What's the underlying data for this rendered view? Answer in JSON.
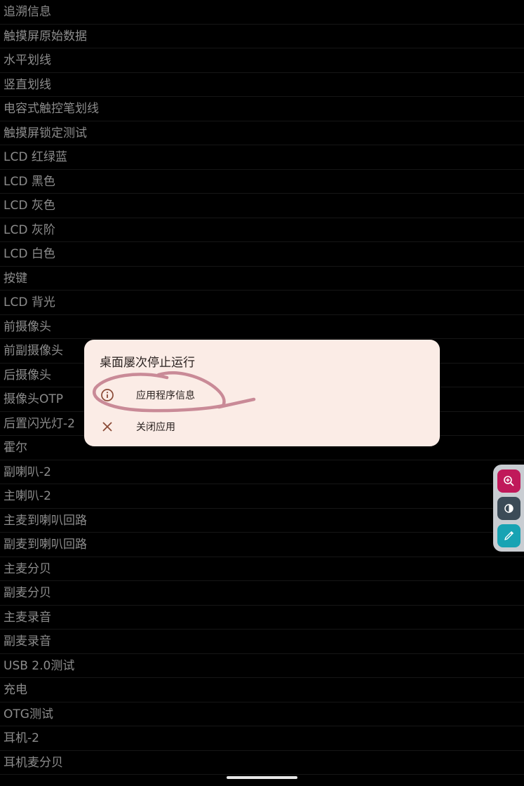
{
  "test_list": [
    "追溯信息",
    "触摸屏原始数据",
    "水平划线",
    "竖直划线",
    "电容式触控笔划线",
    "触摸屏锁定测试",
    "LCD 红绿蓝",
    "LCD 黑色",
    "LCD 灰色",
    "LCD 灰阶",
    "LCD 白色",
    "按键",
    "LCD 背光",
    "前摄像头",
    "前副摄像头",
    "后摄像头",
    "摄像头OTP",
    "后置闪光灯-2",
    "霍尔",
    "副喇叭-2",
    "主喇叭-2",
    "主麦到喇叭回路",
    "副麦到喇叭回路",
    "主麦分贝",
    "副麦分贝",
    "主麦录音",
    "副麦录音",
    "USB 2.0测试",
    "充电",
    "OTG测试",
    "耳机-2",
    "耳机麦分贝"
  ],
  "dialog": {
    "title": "桌面屡次停止运行",
    "app_info_label": "应用程序信息",
    "app_info_icon": "info-icon",
    "close_app_label": "关闭应用",
    "close_app_icon": "close-icon"
  },
  "float_toolbar": {
    "zoom_icon": "zoom-in-icon",
    "contrast_icon": "contrast-icon",
    "picker_icon": "eyedropper-icon"
  },
  "colors": {
    "dialog_bg": "#fbece6",
    "accent_icon": "#8a4a36",
    "annotation_stroke": "#c98a97",
    "zoom_btn": "#c0195a",
    "contrast_btn": "#3b4b57",
    "picker_btn": "#18a3b3"
  }
}
